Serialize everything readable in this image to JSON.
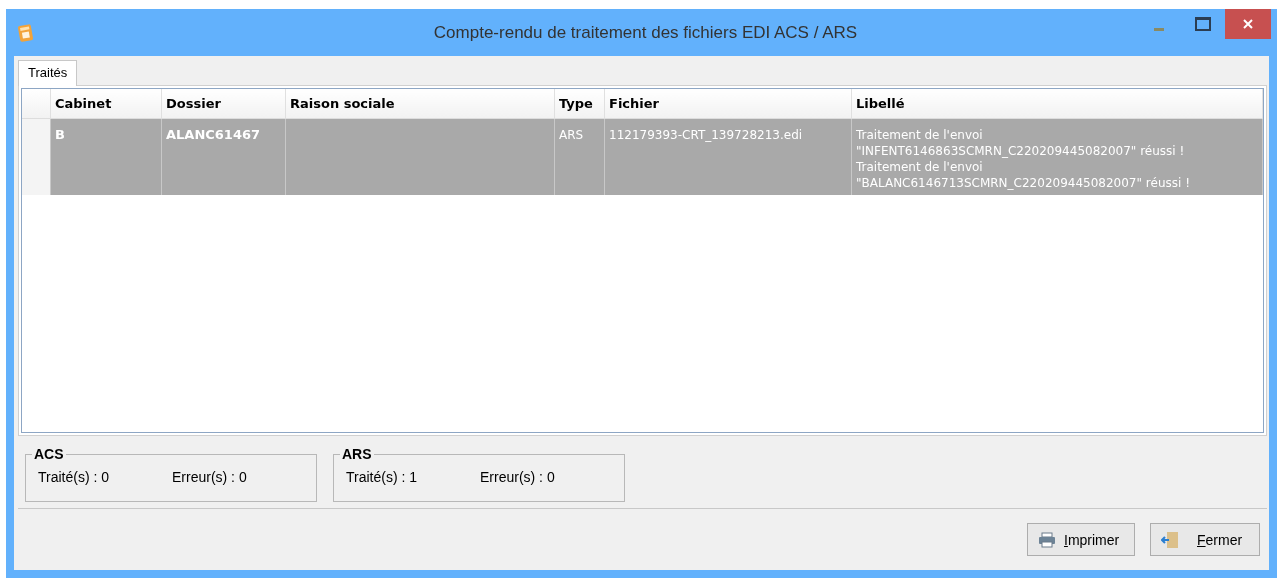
{
  "window": {
    "title": "Compte-rendu de traitement des fichiers EDI ACS / ARS"
  },
  "tabs": [
    {
      "label": "Traités",
      "selected": true
    }
  ],
  "table": {
    "columns": [
      "Cabinet",
      "Dossier",
      "Raison sociale",
      "Type",
      "Fichier",
      "Libellé"
    ],
    "rows": [
      {
        "selected": true,
        "cells": [
          {
            "lines": [
              "B"
            ],
            "bold": true
          },
          {
            "lines": [
              "ALANC61467"
            ],
            "bold": true
          },
          {},
          {
            "lines": [
              "ARS"
            ],
            "bold": false
          },
          {
            "lines": [
              "112179393-CRT_139728213.edi"
            ],
            "bold": false
          },
          {
            "lines": [
              "Traitement de l'envoi",
              "\"INFENT6146863SCMRN_C220209445082007\" réussi !",
              "Traitement de l'envoi",
              "\"BALANC6146713SCMRN_C220209445082007\" réussi !"
            ],
            "bold": false
          }
        ]
      }
    ]
  },
  "groups": [
    {
      "title": "ACS",
      "stats": [
        {
          "label": "Traité(s) :",
          "value": "0"
        },
        {
          "label": "Erreur(s) :",
          "value": "0"
        }
      ]
    },
    {
      "title": "ARS",
      "stats": [
        {
          "label": "Traité(s) :",
          "value": "1"
        },
        {
          "label": "Erreur(s) :",
          "value": "0"
        }
      ]
    }
  ],
  "buttons": [
    {
      "label": "Imprimer",
      "kind": "print"
    },
    {
      "label": "Fermer",
      "kind": "close"
    }
  ]
}
